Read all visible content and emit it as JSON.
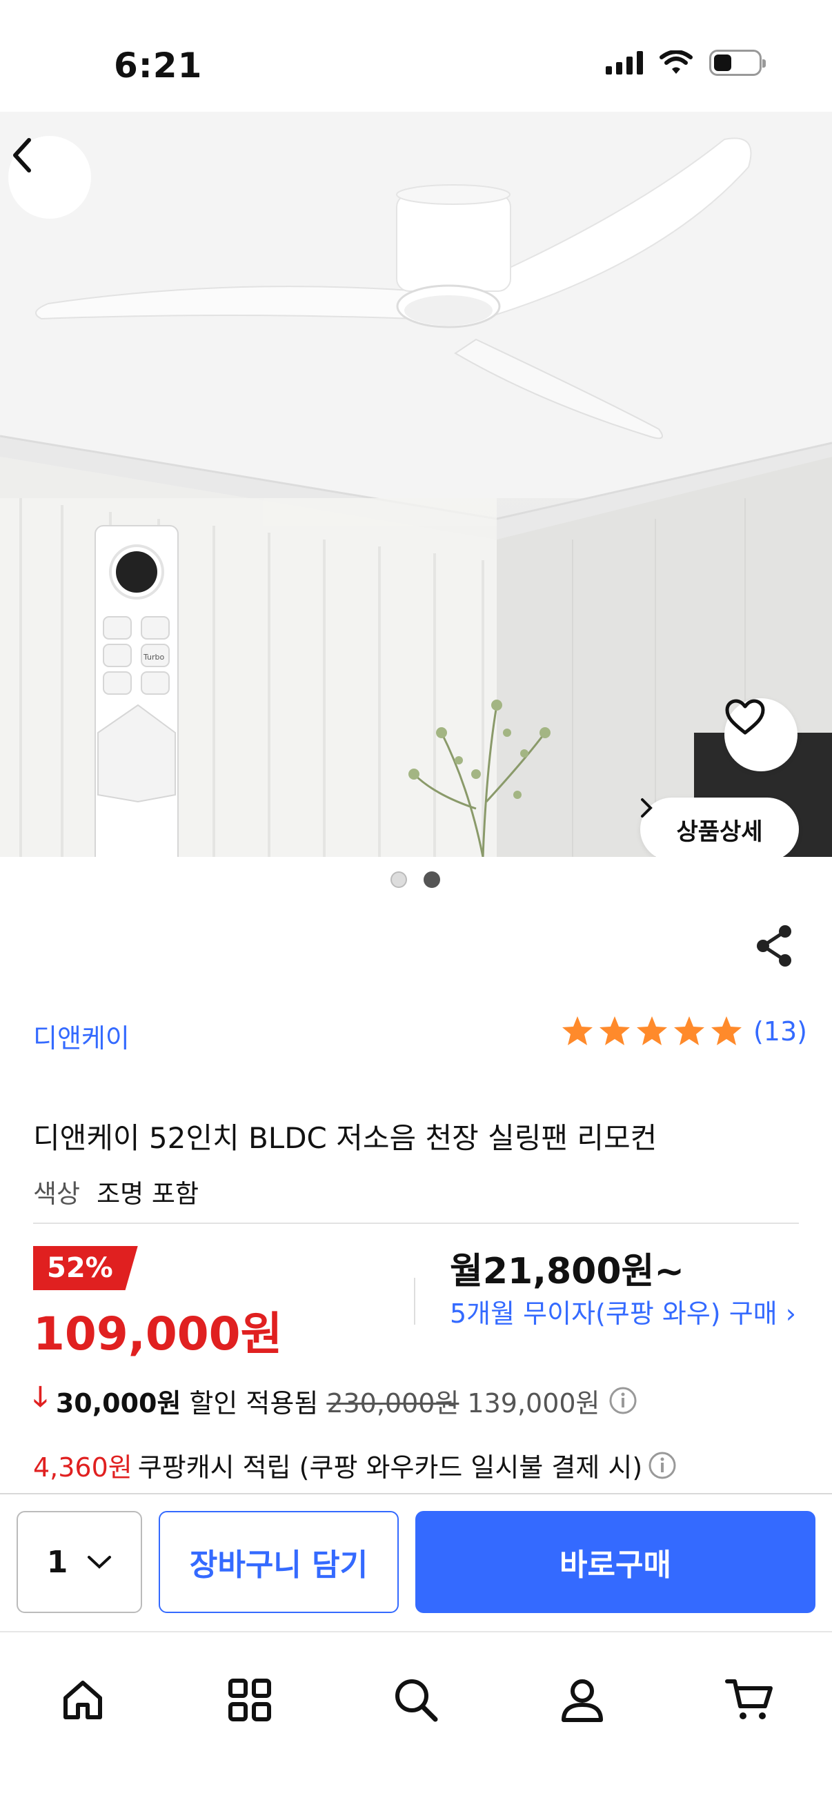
{
  "status": {
    "time": "6:21",
    "icons": [
      "cellular-signal-icon",
      "wifi-icon",
      "battery-icon"
    ]
  },
  "hero": {
    "back_icon": "chevron-left-icon",
    "favorite_icon": "heart-icon",
    "detail_label": "상품상세",
    "remote_label": "Turbo",
    "pager": {
      "current": 2,
      "total": 2
    }
  },
  "product": {
    "share_icon": "share-icon",
    "brand": "디앤케이",
    "rating": {
      "stars": 5,
      "count": "(13)"
    },
    "title": "디앤케이 52인치 BLDC 저소음 천장 실링팬 리모컨",
    "option_label": "색상",
    "option_value": "조명 포함"
  },
  "price": {
    "discount_rate": "52%",
    "sale_price": "109,000원",
    "monthly": "월21,800원~",
    "installment": "5개월 무이자(쿠팡 와우) 구매 ›",
    "discount_amount": "30,000원",
    "discount_text": "할인 적용됨",
    "original_price": "230,000원",
    "previous_price": "139,000원",
    "cash_amount": "4,360원",
    "cash_text": "쿠팡캐시 적립 (쿠팡 와우카드 일시불 결제 시)"
  },
  "purchase": {
    "quantity": "1",
    "cart_label": "장바구니 담기",
    "buy_label": "바로구매"
  },
  "tabs": [
    "home-icon",
    "category-grid-icon",
    "search-icon",
    "my-account-icon",
    "cart-icon"
  ],
  "colors": {
    "accent": "#346aff",
    "sale": "#e02020",
    "star": "#ff8a2b"
  }
}
